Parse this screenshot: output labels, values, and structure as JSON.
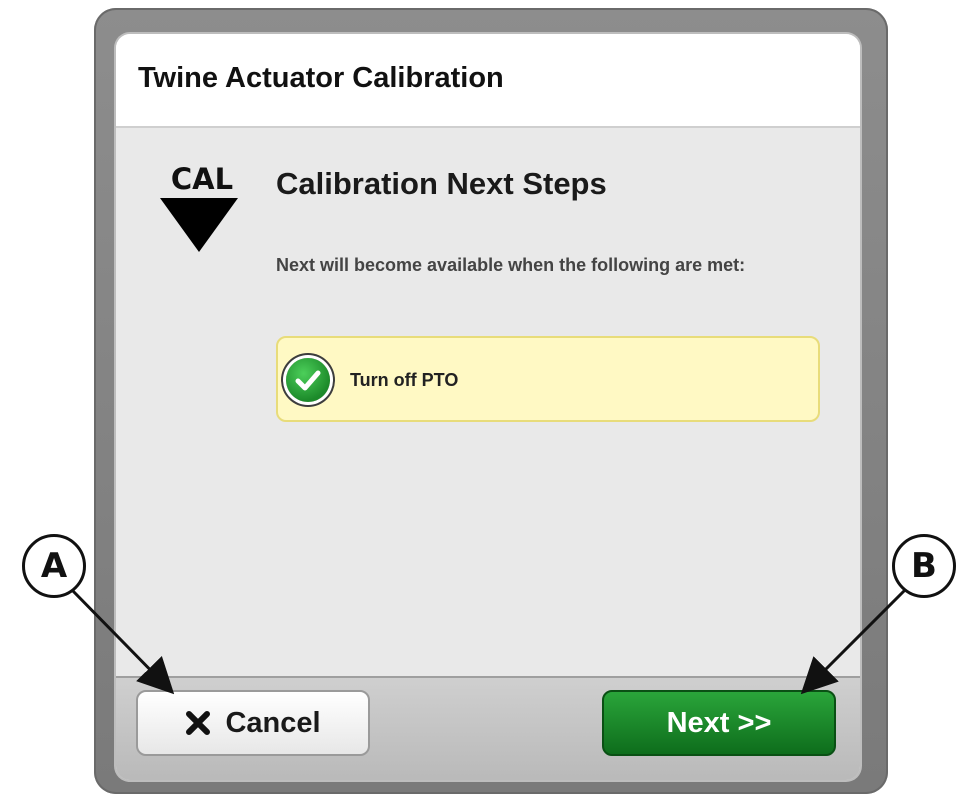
{
  "dialog": {
    "title": "Twine Actuator Calibration",
    "cal_label": "CAL",
    "heading": "Calibration Next Steps",
    "subtext": "Next will become available when the following are met:",
    "conditions": [
      {
        "label": "Turn off PTO",
        "icon": "check-circle-icon",
        "status": "met"
      }
    ]
  },
  "footer": {
    "cancel_label": "Cancel",
    "next_label": "Next >>"
  },
  "callouts": {
    "a": "A",
    "b": "B"
  },
  "colors": {
    "condition_bg": "#fff9c4",
    "next_button": "#1a8a2c",
    "check_icon": "#2bb13b"
  }
}
